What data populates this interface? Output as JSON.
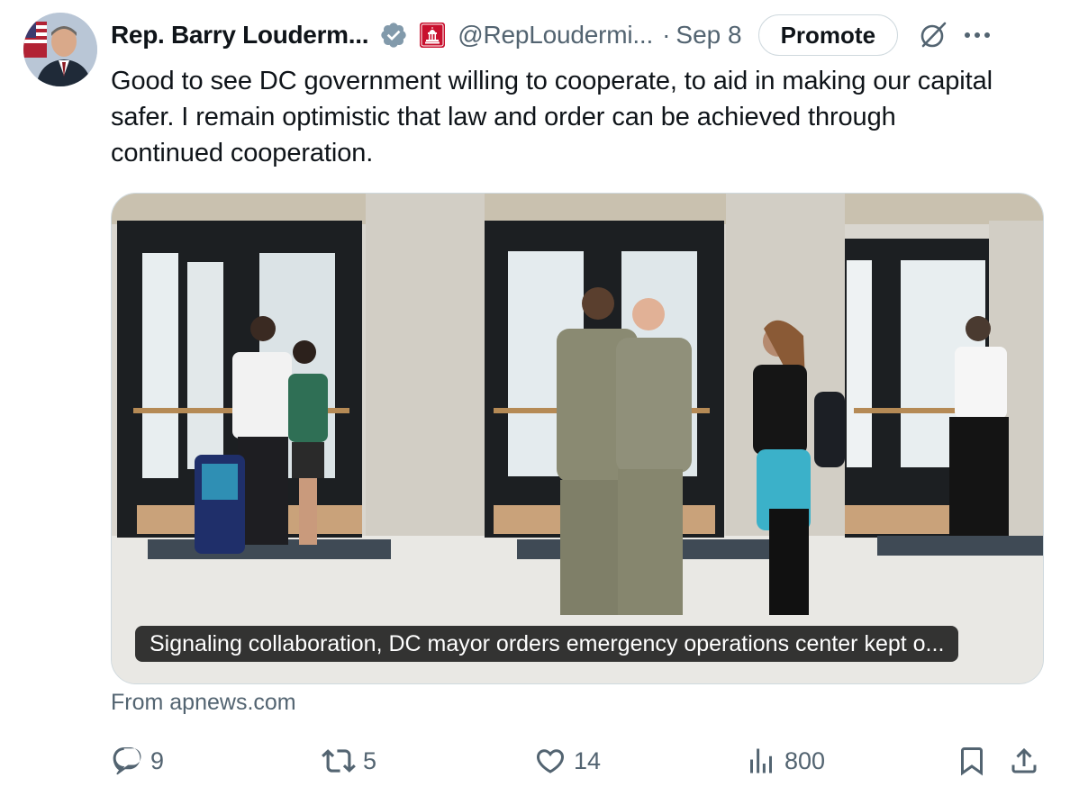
{
  "author": {
    "name": "Rep. Barry Louderm...",
    "handle": "@RepLoudermi...",
    "separator": "·",
    "date": "Sep 8",
    "verified_icon": "verified-badge-icon",
    "affiliation_icon": "capitol-gov-icon"
  },
  "header": {
    "promote_label": "Promote",
    "grok_icon": "grok-icon",
    "more_icon": "more-icon"
  },
  "tweet": {
    "text": "Good to see DC government willing to cooperate, to aid in making our capital safer. I remain optimistic that law and order can be achieved through continued cooperation."
  },
  "card": {
    "caption": "Signaling collaboration, DC mayor orders emergency operations center kept o...",
    "source": "From apnews.com"
  },
  "actions": {
    "replies": "9",
    "reposts": "5",
    "likes": "14",
    "views": "800"
  },
  "colors": {
    "text_primary": "#0f1419",
    "text_secondary": "#536471",
    "verified": "#829aab",
    "gov_badge": "#c8102e",
    "border": "#cfd9de"
  }
}
